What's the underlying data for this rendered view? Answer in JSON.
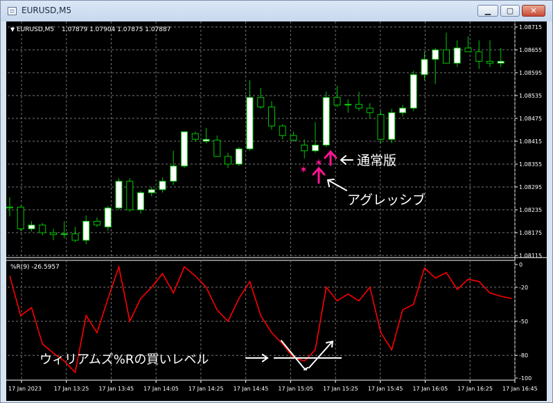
{
  "window": {
    "title": "EURUSD,M5",
    "minimize_icon": "minimize-icon",
    "maximize_icon": "maximize-icon",
    "close_icon": "close-icon",
    "minimize_glyph": "▁",
    "maximize_glyph": "▢",
    "close_glyph": "✕"
  },
  "main_header": {
    "arrow": "▼",
    "symbol": "EURUSD,M5",
    "ohlc": "1.07879 1.07904 1.07875 1.07887"
  },
  "indicator_header": "%R(9) -26.5957",
  "colors": {
    "background": "#000000",
    "bull_candle": "#ffffff",
    "bear_candle": "#000000",
    "wick": "#00c800",
    "wpr_line": "#ff0000",
    "signal_marker": "#ff1493",
    "grid": "#777777",
    "annotation": "#ffffff"
  },
  "price_axis": [
    "1.08715",
    "1.08655",
    "1.08595",
    "1.08535",
    "1.08475",
    "1.08415",
    "1.08355",
    "1.08295",
    "1.08235",
    "1.08175",
    "1.08115"
  ],
  "wpr_axis": [
    "0",
    "-20",
    "-50",
    "-80",
    "-100"
  ],
  "time_axis": [
    "17 Jan 2023",
    "17 Jan 13:25",
    "17 Jan 13:45",
    "17 Jan 14:05",
    "17 Jan 14:25",
    "17 Jan 14:45",
    "17 Jan 15:05",
    "17 Jan 15:25",
    "17 Jan 15:45",
    "17 Jan 16:05",
    "17 Jan 16:25",
    "17 Jan 16:45"
  ],
  "annotations": {
    "normal": "通常版",
    "aggressive": "アグレッシブ",
    "buy_level": "ウィリアムズ%Rの買いレベル"
  },
  "chart_data": [
    {
      "type": "candlestick",
      "title": "EURUSD,M5",
      "y_range": [
        1.08115,
        1.08715
      ],
      "candles": [
        {
          "o": 1.08242,
          "h": 1.08268,
          "l": 1.08218,
          "c": 1.08242
        },
        {
          "o": 1.08242,
          "h": 1.08245,
          "l": 1.0818,
          "c": 1.08185
        },
        {
          "o": 1.08185,
          "h": 1.08205,
          "l": 1.08178,
          "c": 1.08195
        },
        {
          "o": 1.08195,
          "h": 1.082,
          "l": 1.08168,
          "c": 1.08175
        },
        {
          "o": 1.08175,
          "h": 1.08185,
          "l": 1.08155,
          "c": 1.0817
        },
        {
          "o": 1.0817,
          "h": 1.08205,
          "l": 1.0816,
          "c": 1.08172
        },
        {
          "o": 1.08172,
          "h": 1.0819,
          "l": 1.0815,
          "c": 1.08155
        },
        {
          "o": 1.08155,
          "h": 1.0822,
          "l": 1.08145,
          "c": 1.08205
        },
        {
          "o": 1.08205,
          "h": 1.08215,
          "l": 1.0819,
          "c": 1.08195
        },
        {
          "o": 1.0819,
          "h": 1.08245,
          "l": 1.0818,
          "c": 1.0824
        },
        {
          "o": 1.0824,
          "h": 1.08318,
          "l": 1.08235,
          "c": 1.0831
        },
        {
          "o": 1.0831,
          "h": 1.08318,
          "l": 1.0823,
          "c": 1.08235
        },
        {
          "o": 1.08235,
          "h": 1.08285,
          "l": 1.08225,
          "c": 1.0828
        },
        {
          "o": 1.0828,
          "h": 1.08295,
          "l": 1.0827,
          "c": 1.08288
        },
        {
          "o": 1.08288,
          "h": 1.0832,
          "l": 1.0828,
          "c": 1.0831
        },
        {
          "o": 1.0831,
          "h": 1.0839,
          "l": 1.083,
          "c": 1.0835
        },
        {
          "o": 1.0835,
          "h": 1.0844,
          "l": 1.08345,
          "c": 1.0844
        },
        {
          "o": 1.08435,
          "h": 1.0844,
          "l": 1.08415,
          "c": 1.0842
        },
        {
          "o": 1.08415,
          "h": 1.0845,
          "l": 1.0841,
          "c": 1.0842
        },
        {
          "o": 1.08418,
          "h": 1.0843,
          "l": 1.08375,
          "c": 1.08375
        },
        {
          "o": 1.08375,
          "h": 1.08385,
          "l": 1.08345,
          "c": 1.08355
        },
        {
          "o": 1.08355,
          "h": 1.084,
          "l": 1.0835,
          "c": 1.08395
        },
        {
          "o": 1.08395,
          "h": 1.08575,
          "l": 1.0839,
          "c": 1.0853
        },
        {
          "o": 1.0853,
          "h": 1.08555,
          "l": 1.085,
          "c": 1.08505
        },
        {
          "o": 1.08505,
          "h": 1.0852,
          "l": 1.08445,
          "c": 1.08455
        },
        {
          "o": 1.08455,
          "h": 1.0846,
          "l": 1.0842,
          "c": 1.0843
        },
        {
          "o": 1.0843,
          "h": 1.0844,
          "l": 1.08415,
          "c": 1.08418
        },
        {
          "o": 1.08405,
          "h": 1.0842,
          "l": 1.0837,
          "c": 1.0839
        },
        {
          "o": 1.0839,
          "h": 1.08465,
          "l": 1.08385,
          "c": 1.08405
        },
        {
          "o": 1.08405,
          "h": 1.08545,
          "l": 1.084,
          "c": 1.0853
        },
        {
          "o": 1.0853,
          "h": 1.0856,
          "l": 1.08505,
          "c": 1.0851
        },
        {
          "o": 1.0851,
          "h": 1.08525,
          "l": 1.0849,
          "c": 1.08512
        },
        {
          "o": 1.08512,
          "h": 1.08545,
          "l": 1.08495,
          "c": 1.08502
        },
        {
          "o": 1.08502,
          "h": 1.08515,
          "l": 1.08475,
          "c": 1.0849
        },
        {
          "o": 1.08485,
          "h": 1.08495,
          "l": 1.0841,
          "c": 1.0842
        },
        {
          "o": 1.0842,
          "h": 1.085,
          "l": 1.0841,
          "c": 1.0849
        },
        {
          "o": 1.0849,
          "h": 1.0851,
          "l": 1.0848,
          "c": 1.08502
        },
        {
          "o": 1.08502,
          "h": 1.086,
          "l": 1.08495,
          "c": 1.0859
        },
        {
          "o": 1.0859,
          "h": 1.0865,
          "l": 1.08575,
          "c": 1.0863
        },
        {
          "o": 1.0863,
          "h": 1.0866,
          "l": 1.08565,
          "c": 1.08655
        },
        {
          "o": 1.08655,
          "h": 1.087,
          "l": 1.08625,
          "c": 1.0862
        },
        {
          "o": 1.0862,
          "h": 1.0868,
          "l": 1.0861,
          "c": 1.0866
        },
        {
          "o": 1.0866,
          "h": 1.0869,
          "l": 1.0865,
          "c": 1.0865
        },
        {
          "o": 1.0865,
          "h": 1.0868,
          "l": 1.08605,
          "c": 1.08625
        },
        {
          "o": 1.08625,
          "h": 1.0868,
          "l": 1.0861,
          "c": 1.0862
        },
        {
          "o": 1.0862,
          "h": 1.0866,
          "l": 1.0861,
          "c": 1.08625
        }
      ]
    },
    {
      "type": "line",
      "title": "%R(9) -26.5957",
      "y_range": [
        -100,
        0
      ],
      "series": [
        {
          "values": [
            -10,
            -45,
            -38,
            -70,
            -78,
            -85,
            -95,
            -45,
            -60,
            -30,
            -2,
            -50,
            -30,
            -20,
            -8,
            -25,
            -2,
            -10,
            -20,
            -40,
            -50,
            -30,
            -15,
            -45,
            -60,
            -70,
            -82,
            -85,
            -75,
            -20,
            -32,
            -26,
            -32,
            -20,
            -60,
            -75,
            -40,
            -35,
            -3,
            -12,
            -7,
            -22,
            -13,
            -15,
            -25,
            -28,
            -30
          ]
        }
      ]
    }
  ]
}
